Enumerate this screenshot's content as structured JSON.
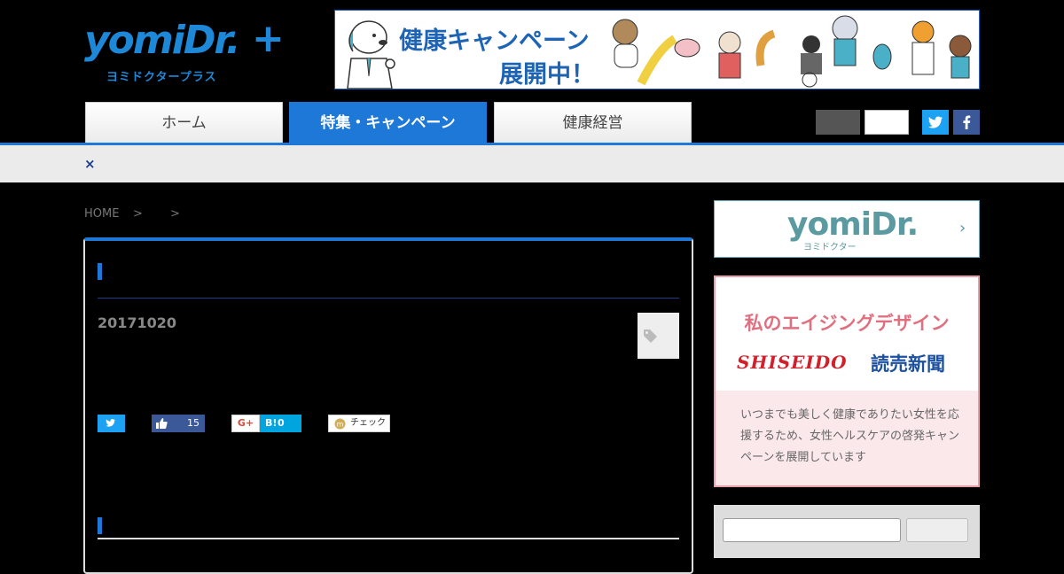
{
  "header": {
    "logo_main": "yomiDr.",
    "logo_plus": "+",
    "logo_sub": "ヨミドクタープラス",
    "banner": {
      "line1": "健康キャンペーン",
      "line2": "展開中！"
    }
  },
  "nav": {
    "tabs": [
      {
        "label": "ホーム",
        "active": false
      },
      {
        "label": "特集・キャンペーン",
        "active": true
      },
      {
        "label": "健康経営",
        "active": false
      }
    ],
    "accent_color": "#1e78d8"
  },
  "notice": {
    "close_label": "×"
  },
  "breadcrumb": {
    "home": "HOME",
    "sep": ">"
  },
  "article": {
    "date": "20171020",
    "share": {
      "facebook_count": "15",
      "gplus_label": "G+",
      "hatena_label": "B!",
      "hatena_count": "0",
      "check_label": "チェック"
    }
  },
  "sidebar": {
    "yomidr": {
      "logo": "yomiDr.",
      "sub": "ヨミドクター",
      "arrow": "›"
    },
    "aging": {
      "title": "私のエイジングデザイン",
      "brand1": "SHISEIDO",
      "brand2": "読売新聞",
      "text": "いつまでも美しく健康でありたい女性を応援するため、女性ヘルスケアの啓発キャンペーンを展開しています"
    }
  }
}
